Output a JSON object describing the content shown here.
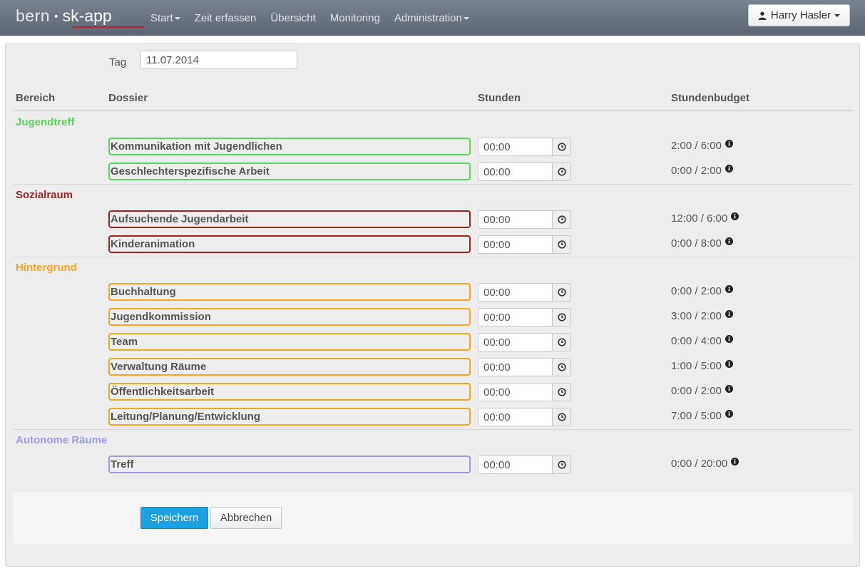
{
  "brand": {
    "left": "bern",
    "right": "sk-app"
  },
  "nav": {
    "items": [
      {
        "label": "Start",
        "dropdown": true
      },
      {
        "label": "Zeit erfassen",
        "dropdown": false
      },
      {
        "label": "Übersicht",
        "dropdown": false
      },
      {
        "label": "Monitoring",
        "dropdown": false
      },
      {
        "label": "Administration",
        "dropdown": true
      }
    ],
    "user": "Harry Hasler"
  },
  "form": {
    "day_label": "Tag",
    "day_value": "11.07.2014",
    "columns": {
      "bereich": "Bereich",
      "dossier": "Dossier",
      "stunden": "Stunden",
      "budget": "Stundenbudget"
    },
    "categories": [
      {
        "name": "Jugendtreff",
        "color": "#5fd35f",
        "rows": [
          {
            "dossier": "Kommunikation mit Jugendlichen",
            "hours": "00:00",
            "budget": "2:00 / 6:00"
          },
          {
            "dossier": "Geschlechterspezifische Arbeit",
            "hours": "00:00",
            "budget": "0:00 / 2:00"
          }
        ]
      },
      {
        "name": "Sozialraum",
        "color": "#9e2222",
        "rows": [
          {
            "dossier": "Aufsuchende Jugendarbeit",
            "hours": "00:00",
            "budget": "12:00 / 6:00"
          },
          {
            "dossier": "Kinderanimation",
            "hours": "00:00",
            "budget": "0:00 / 8:00"
          }
        ]
      },
      {
        "name": "Hintergrund",
        "color": "#f5a623",
        "rows": [
          {
            "dossier": "Buchhaltung",
            "hours": "00:00",
            "budget": "0:00 / 2:00"
          },
          {
            "dossier": "Jugendkommission",
            "hours": "00:00",
            "budget": "3:00 / 2:00"
          },
          {
            "dossier": "Team",
            "hours": "00:00",
            "budget": "0:00 / 4:00"
          },
          {
            "dossier": "Verwaltung Räume",
            "hours": "00:00",
            "budget": "1:00 / 5:00"
          },
          {
            "dossier": "Öffentlichkeitsarbeit",
            "hours": "00:00",
            "budget": "0:00 / 2:00"
          },
          {
            "dossier": "Leitung/Planung/Entwicklung",
            "hours": "00:00",
            "budget": "7:00 / 5:00"
          }
        ]
      },
      {
        "name": "Autonome Räume",
        "color": "#9b9be8",
        "rows": [
          {
            "dossier": "Treff",
            "hours": "00:00",
            "budget": "0:00 / 20:00"
          }
        ]
      }
    ],
    "buttons": {
      "save": "Speichern",
      "cancel": "Abbrechen"
    }
  }
}
